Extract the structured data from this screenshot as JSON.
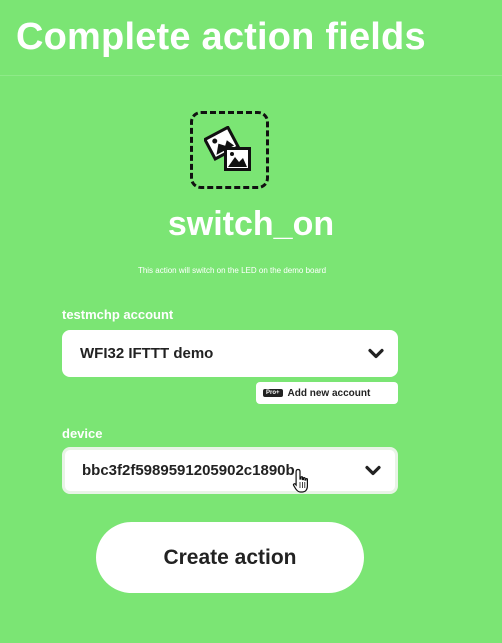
{
  "header": {
    "title": "Complete action fields"
  },
  "action": {
    "icon": "photo-gallery-icon",
    "name": "switch_on",
    "description": "This action will switch on the LED on the demo board"
  },
  "fields": {
    "account": {
      "label": "testmchp account",
      "value": "WFI32 IFTTT demo"
    },
    "add_account": {
      "badge": "Pro+",
      "label": "Add new account"
    },
    "device": {
      "label": "device",
      "value": "bbc3f2f5989591205902c1890b"
    }
  },
  "create_button": {
    "label": "Create action"
  },
  "colors": {
    "background": "#7be574",
    "surface": "#ffffff",
    "text_dark": "#222222"
  }
}
